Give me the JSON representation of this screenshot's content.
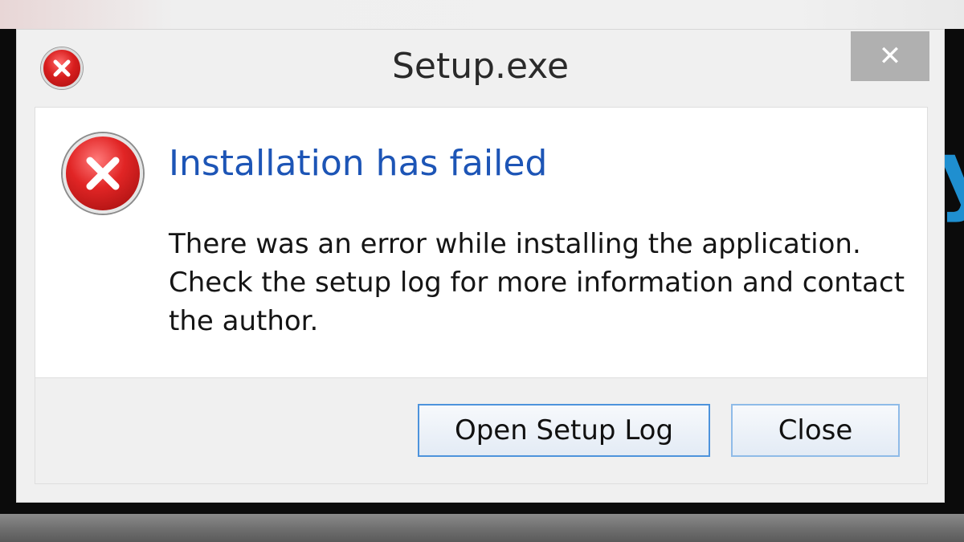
{
  "window": {
    "title": "Setup.exe",
    "close_symbol": "✕"
  },
  "content": {
    "heading": "Installation has failed",
    "message": "There was an error while installing the application. Check the setup log for more information and contact the author."
  },
  "buttons": {
    "open_log_label": "Open Setup Log",
    "close_label": "Close"
  },
  "icons": {
    "title_icon": "error-icon",
    "content_icon": "error-icon",
    "error_color": "#d81e1e"
  },
  "colors": {
    "heading": "#1d55b6",
    "button_border": "#4d93dc"
  }
}
